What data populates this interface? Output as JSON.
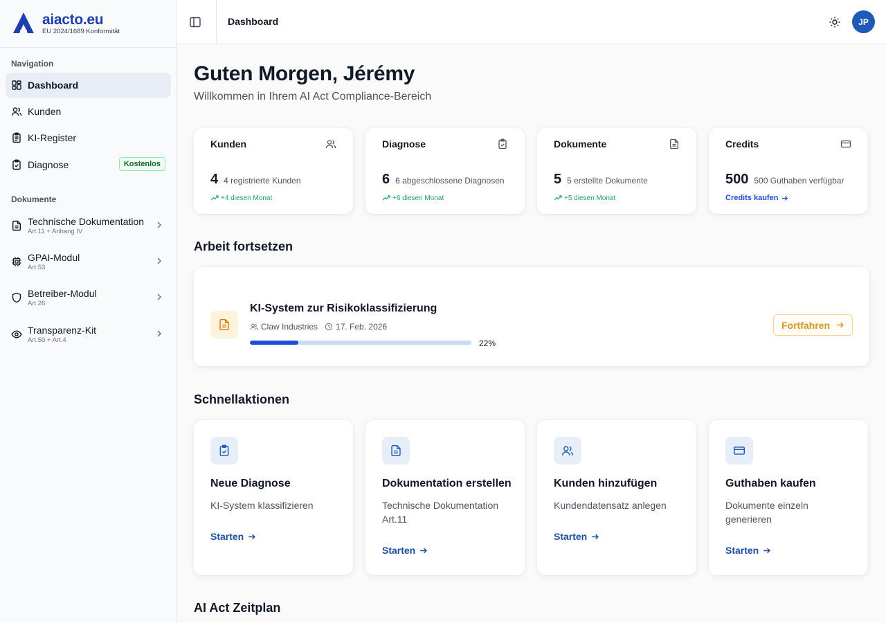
{
  "brand": {
    "name": "aiacto.eu",
    "subtitle": "EU 2024/1689 Konformität"
  },
  "sidebar": {
    "nav_section": "Navigation",
    "nav_items": [
      {
        "label": "Dashboard",
        "icon": "dashboard-icon"
      },
      {
        "label": "Kunden",
        "icon": "users-icon"
      },
      {
        "label": "KI-Register",
        "icon": "clipboard-list-icon"
      },
      {
        "label": "Diagnose",
        "icon": "clipboard-check-icon",
        "badge": "Kostenlos"
      }
    ],
    "doc_section": "Dokumente",
    "doc_items": [
      {
        "label": "Technische Dokumentation",
        "sub": "Art.11 + Anhang IV",
        "icon": "file-text-icon"
      },
      {
        "label": "GPAI-Modul",
        "sub": "Art.53",
        "icon": "cpu-icon"
      },
      {
        "label": "Betreiber-Modul",
        "sub": "Art.26",
        "icon": "shield-icon"
      },
      {
        "label": "Transparenz-Kit",
        "sub": "Art.50 + Art.4",
        "icon": "eye-icon"
      }
    ]
  },
  "header": {
    "breadcrumb": "Dashboard",
    "avatar_initials": "JP"
  },
  "main": {
    "greeting": "Guten Morgen, Jérémy",
    "welcome": "Willkommen in Ihrem AI Act Compliance-Bereich",
    "stats": [
      {
        "title": "Kunden",
        "value": "4",
        "desc": "4 registrierte Kunden",
        "trend": "+4 diesen Monat",
        "icon": "users-icon"
      },
      {
        "title": "Diagnose",
        "value": "6",
        "desc": "6 abgeschlossene Diagnosen",
        "trend": "+6 diesen Monat",
        "icon": "clipboard-check-icon"
      },
      {
        "title": "Dokumente",
        "value": "5",
        "desc": "5 erstellte Dokumente",
        "trend": "+5 diesen Monat",
        "icon": "file-text-icon"
      },
      {
        "title": "Credits",
        "value": "500",
        "desc": "500 Guthaben verfügbar",
        "link": "Credits kaufen",
        "icon": "credit-card-icon"
      }
    ],
    "continue_section": "Arbeit fortsetzen",
    "continue_item": {
      "title": "KI-System zur Risikoklassifizierung",
      "client": "Claw Industries",
      "date": "17. Feb. 2026",
      "progress": 22,
      "progress_label": "22%",
      "button": "Fortfahren"
    },
    "quick_section": "Schnellaktionen",
    "quick_actions": [
      {
        "title": "Neue Diagnose",
        "desc": "KI-System klassifizieren",
        "link": "Starten",
        "icon": "clipboard-check-icon"
      },
      {
        "title": "Dokumentation erstellen",
        "desc": "Technische Dokumentation Art.11",
        "link": "Starten",
        "icon": "file-text-icon"
      },
      {
        "title": "Kunden hinzufügen",
        "desc": "Kundendatensatz anlegen",
        "link": "Starten",
        "icon": "users-icon"
      },
      {
        "title": "Guthaben kaufen",
        "desc": "Dokumente einzeln generieren",
        "link": "Starten",
        "icon": "credit-card-icon"
      }
    ],
    "timeline_section": "AI Act Zeitplan"
  },
  "colors": {
    "accent": "#1e5bb8",
    "brand": "#1e40af",
    "success": "#22a35a",
    "warning": "#d9961a"
  }
}
